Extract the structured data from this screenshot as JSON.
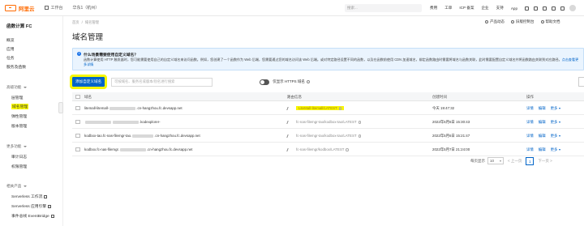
{
  "topbar": {
    "brand": "阿里云",
    "workspace": "工作台",
    "region": "华东1（杭州）",
    "search_placeholder": "搜索...",
    "links": [
      "费用",
      "工单",
      "ICP 备案",
      "企业",
      "支持",
      "App"
    ]
  },
  "sidebar": {
    "title": "函数计算 FC",
    "top_items": [
      "概览",
      "应用",
      "任务",
      "服务及函数"
    ],
    "groups": [
      {
        "label": "高级功能",
        "items": [
          "层管理",
          "域名管理",
          "弹性管理",
          "版本管理"
        ]
      },
      {
        "label": "更多功能",
        "items": [
          "审计日志",
          "权限管理"
        ]
      },
      {
        "label": "相关产品",
        "items": [
          "Serverless 工作流",
          "Serverless 应用引擎",
          "事件总线 EventBridge"
        ]
      }
    ],
    "active_item": "域名管理"
  },
  "breadcrumb": [
    "首页",
    "域名管理"
  ],
  "header_actions": [
    "产品动态",
    "旧版控制台",
    "帮助文档"
  ],
  "page_title": "域名管理",
  "notice": {
    "title": "什么场景需要使用自定义域名？",
    "body": "函数计算使用 HTTP 触发器时，您可能需要使用自己的自定义域名来访问函数。例如，您创建了一个函数作为 Web 后端，您需要通过您的域名访问该 Web 后端。或对特定路径设置不同的函数，以及在函数前使用 CDN 加速域名，绑定函数路由时需要将域名与函数关联，此时需要配置自定义域名并将函数路由关联到对应路径。",
    "link": "点击查看更多详情"
  },
  "toolbar": {
    "add_button": "添加自定义域名",
    "filter_placeholder": "可按域名、服务名或版本/别名进行搜索",
    "toggle_label": "仅显示 HTTPS 域名"
  },
  "table": {
    "columns": [
      "域名",
      "路由信息",
      "创建时间",
      "操作"
    ],
    "rows": [
      {
        "domain_prefix": "litemall-litemall-",
        "domain_suffix": ".cn-hangzhou.fc.devsapp.net",
        "route": "LiteMall-litemall/LATEST",
        "highlight": true,
        "created": "今天 19:47:32",
        "actions": [
          "详情",
          "编辑",
          "更多"
        ]
      },
      {
        "domain_prefix": "",
        "domain_suffix": ".kodexplorer-",
        "route": "fc-nas-filemgr-tao/kodbox-tao/LATEST",
        "highlight": false,
        "created": "2022年5月6日 15:30:43",
        "actions": [
          "详情",
          "编辑",
          "更多"
        ]
      },
      {
        "domain_prefix": "kodbox-tao.fc-nas-filemgr-tao.",
        "domain_suffix": ".cn-hangzhou.fc.devsapp.net",
        "route": "fc-nas-filemgr-tao/kodbox-tao/LATEST",
        "highlight": false,
        "created": "2022年5月6日 15:21:47",
        "actions": [
          "详情",
          "编辑",
          "更多"
        ]
      },
      {
        "domain_prefix": "kodbox.fc-nas-filemgr.",
        "domain_suffix": ".cn-hangzhou.fc.devsapp.net",
        "route": "fc-nas-filemgr/kodbox/LATEST",
        "highlight": false,
        "created": "2022年5月7日 21:24:00",
        "actions": [
          "详情",
          "编辑",
          "更多"
        ]
      }
    ]
  },
  "pagination": {
    "page_size_label": "每页显示",
    "page_size": "10",
    "current_page": "1",
    "prev": "< 上一页",
    "next": "下一页 >"
  },
  "colors": {
    "brand": "#ff6a00",
    "primary": "#0064c8",
    "highlight": "#ffff00",
    "notice_bg": "#eaf4fe"
  }
}
